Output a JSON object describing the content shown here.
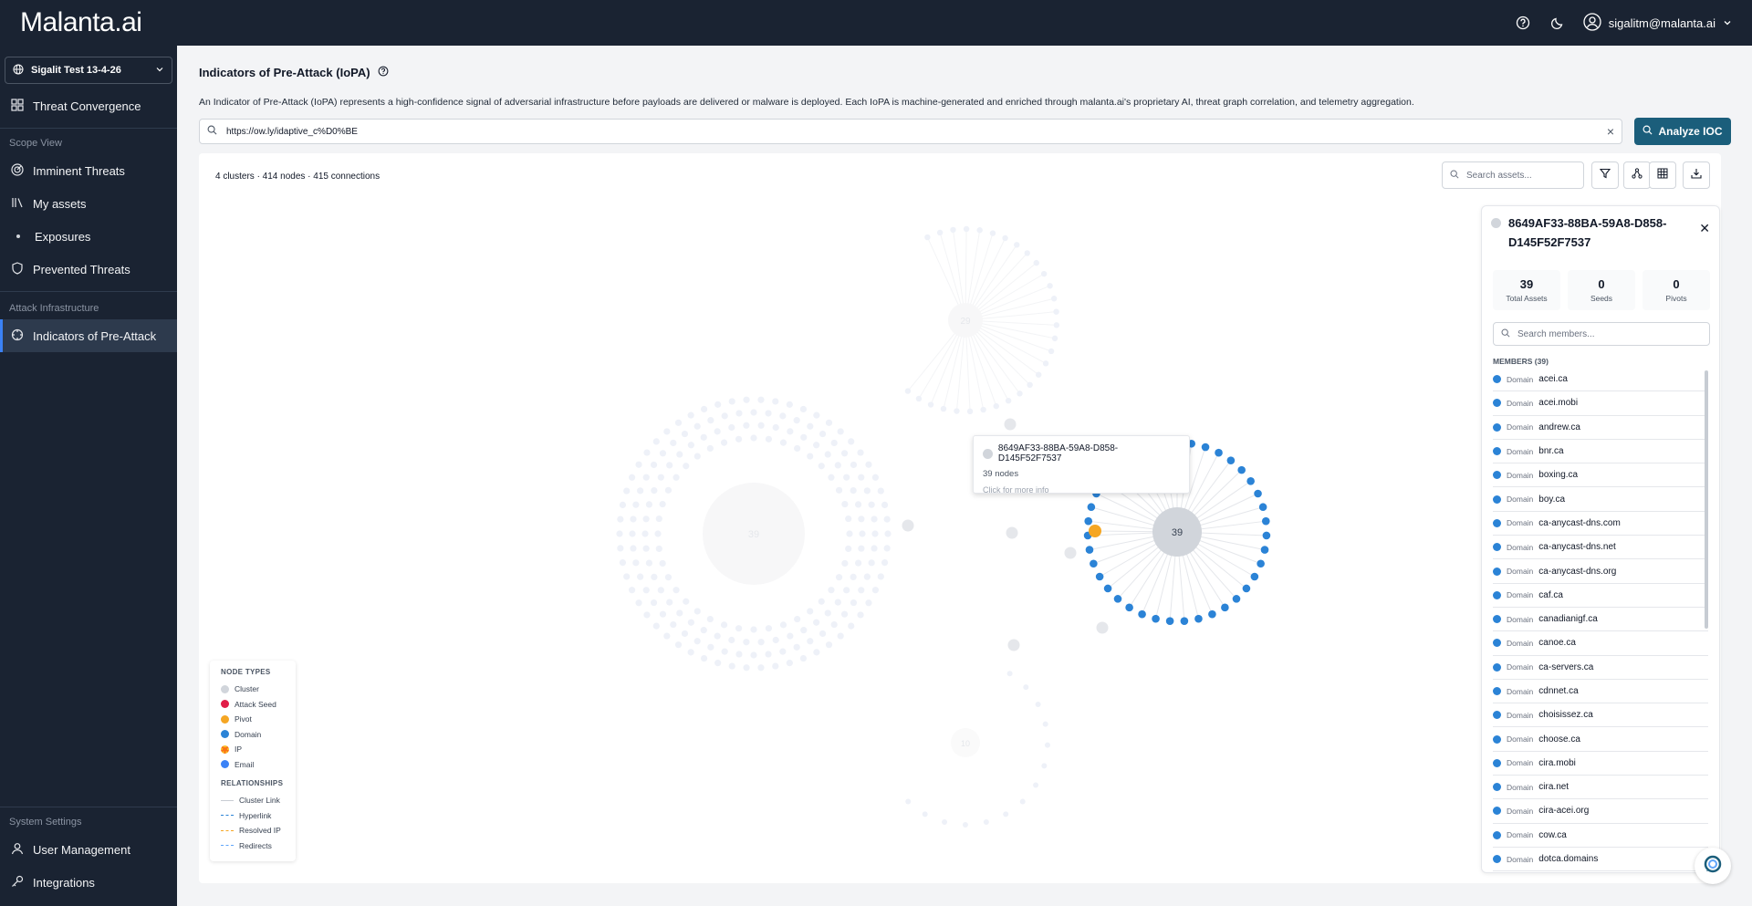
{
  "app": {
    "logo": "Malanta.ai",
    "user_email": "sigalitm@malanta.ai"
  },
  "sidebar": {
    "org": "Sigalit Test 13-4-26",
    "top_item": "Threat Convergence",
    "scope_label": "Scope View",
    "scope_items": [
      "Imminent Threats",
      "My assets",
      "Exposures",
      "Prevented Threats"
    ],
    "attack_label": "Attack Infrastructure",
    "attack_item": "Indicators of Pre-Attack",
    "system_label": "System Settings",
    "system_items": [
      "User Management",
      "Integrations"
    ]
  },
  "page": {
    "title": "Indicators of Pre-Attack (IoPA)",
    "description": "An Indicator of Pre-Attack (IoPA) represents a high-confidence signal of adversarial infrastructure before payloads are delivered or malware is deployed. Each IoPA is machine-generated and enriched through malanta.ai's proprietary AI, threat graph correlation, and telemetry aggregation.",
    "search_value": "https://ow.ly/idaptive_c%D0%BE",
    "analyze_label": "Analyze IOC"
  },
  "graph": {
    "stats": "4 clusters · 414 nodes · 415 connections",
    "asset_search_placeholder": "Search assets...",
    "cluster_labels": [
      "29",
      "39",
      "10",
      "39"
    ],
    "colors": {
      "cluster": "#d1d5db",
      "seed": "#e11d48",
      "pivot": "#f5a623",
      "domain": "#2b83d6",
      "ip": "#f97316",
      "email": "#3b82f6"
    }
  },
  "legend": {
    "node_types_title": "NODE TYPES",
    "node_types": [
      "Cluster",
      "Attack Seed",
      "Pivot",
      "Domain",
      "IP",
      "Email"
    ],
    "relationships_title": "RELATIONSHIPS",
    "relationships": [
      "Cluster Link",
      "Hyperlink",
      "Resolved IP",
      "Redirects"
    ]
  },
  "tooltip": {
    "title": "8649AF33-88BA-59A8-D858-D145F52F7537",
    "nodes": "39 nodes",
    "hint": "Click for more info"
  },
  "panel": {
    "title": "8649AF33-88BA-59A8-D858-D145F52F7537",
    "stats": [
      {
        "value": "39",
        "label": "Total Assets"
      },
      {
        "value": "0",
        "label": "Seeds"
      },
      {
        "value": "0",
        "label": "Pivots"
      }
    ],
    "member_search_placeholder": "Search members...",
    "members_label": "MEMBERS (39)",
    "member_type": "Domain",
    "members": [
      "acei.ca",
      "acei.mobi",
      "andrew.ca",
      "bnr.ca",
      "boxing.ca",
      "boy.ca",
      "ca-anycast-dns.com",
      "ca-anycast-dns.net",
      "ca-anycast-dns.org",
      "caf.ca",
      "canadianigf.ca",
      "canoe.ca",
      "ca-servers.ca",
      "cdnnet.ca",
      "choisissez.ca",
      "choose.ca",
      "cira.mobi",
      "cira.net",
      "cira-acei.org",
      "cow.ca",
      "dotca.domains"
    ]
  }
}
